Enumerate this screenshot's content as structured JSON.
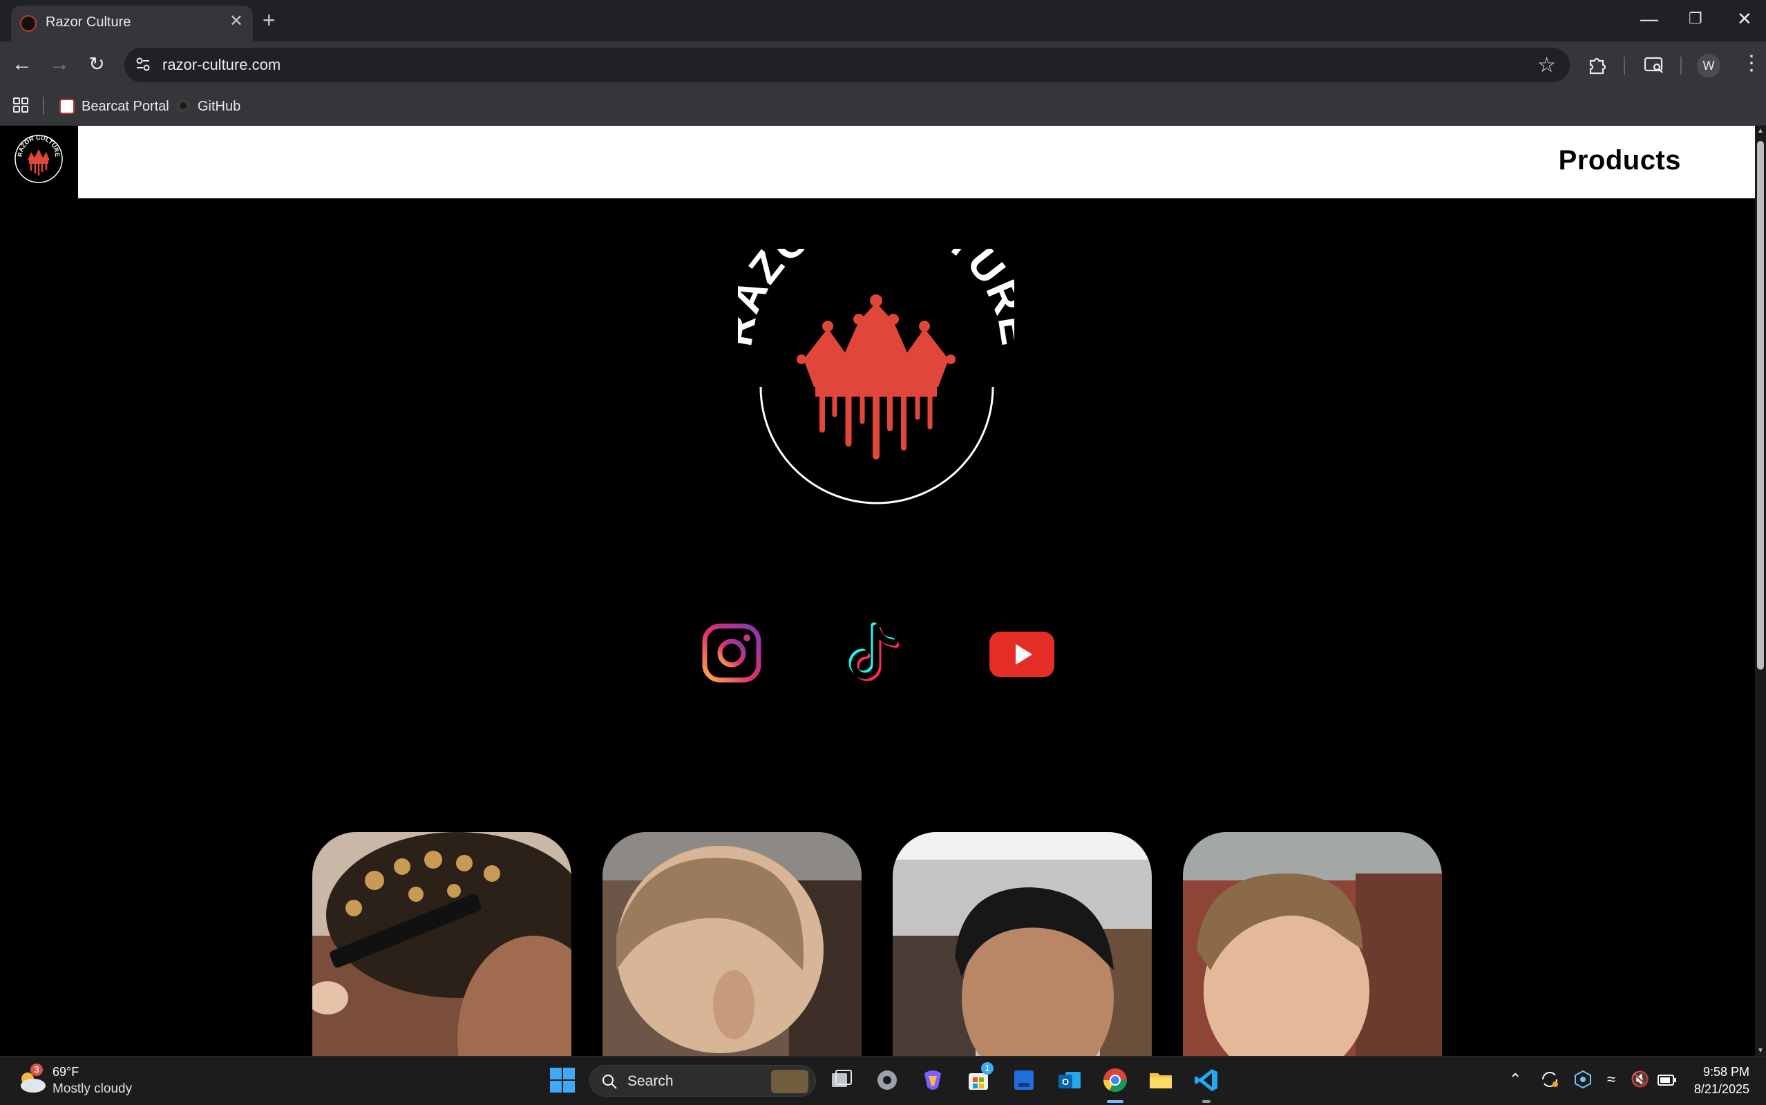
{
  "browser": {
    "tab_title": "Razor Culture",
    "tab_close": "✕",
    "new_tab": "+",
    "url": "razor-culture.com",
    "profile_initial": "W",
    "window_controls": {
      "minimize": "—",
      "restore": "❐",
      "close": "✕"
    }
  },
  "bookmarks": [
    {
      "label": "Bearcat Portal",
      "icon": "bearcat-portal-favicon"
    },
    {
      "label": "GitHub",
      "icon": "github-icon"
    }
  ],
  "site": {
    "nav": {
      "products_label": "Products"
    },
    "logo_text": "RAZOR CULTURE",
    "social_links": [
      "instagram-icon",
      "tiktok-icon",
      "youtube-icon"
    ],
    "gallery_count_visible": 4
  },
  "taskbar": {
    "weather": {
      "temp": "69°F",
      "desc": "Mostly cloudy",
      "badge": "3"
    },
    "search_label": "Search",
    "store_badge": "1",
    "clock": {
      "time": "9:58 PM",
      "date": "8/21/2025"
    }
  },
  "colors": {
    "accent_red": "#e0473a",
    "header_bg": "#ffffff",
    "page_bg": "#000000",
    "chrome_bg": "#35363a"
  }
}
